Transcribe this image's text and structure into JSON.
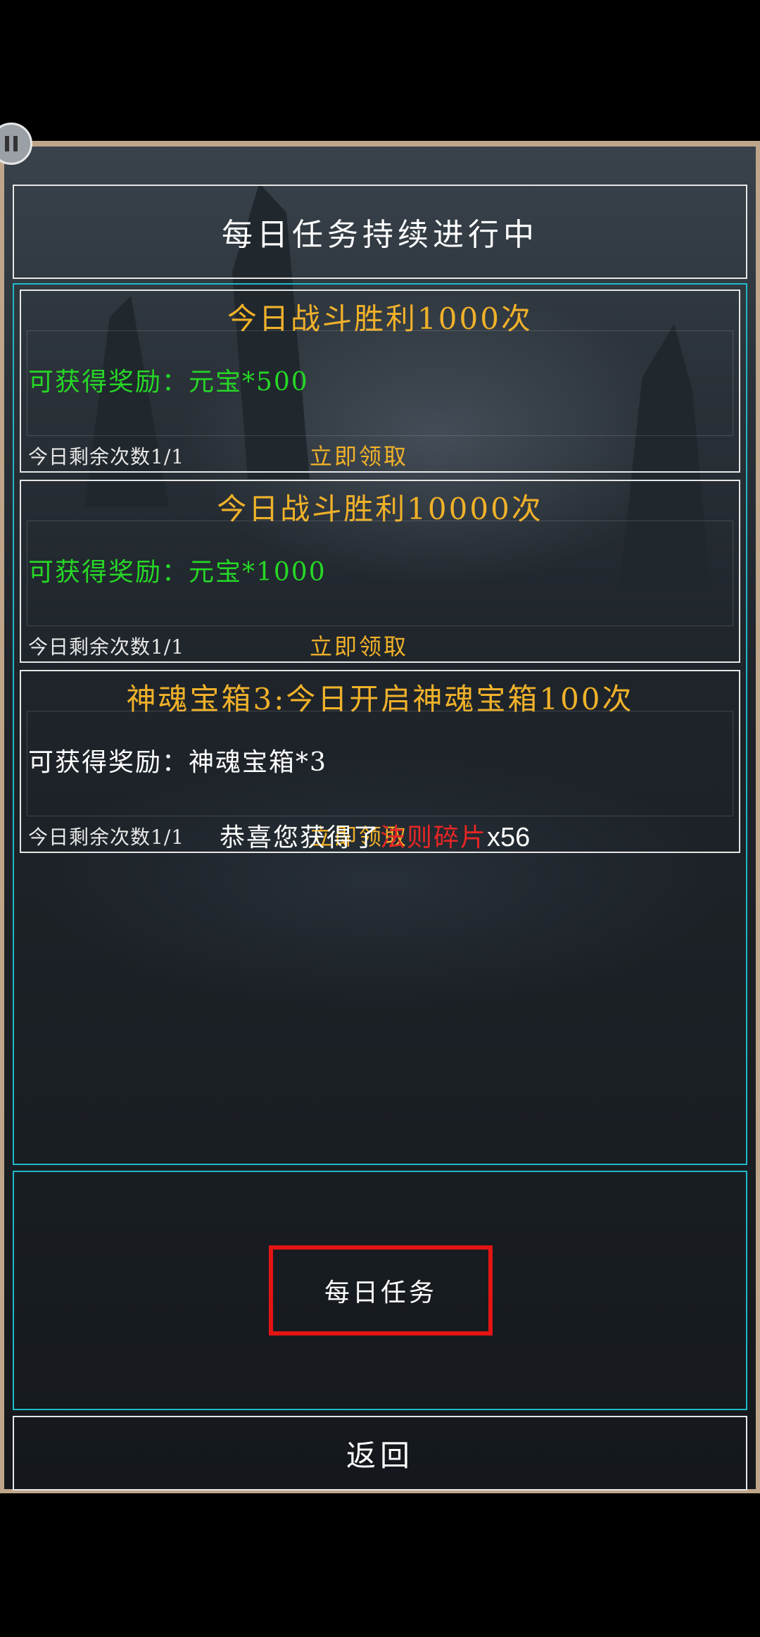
{
  "header": {
    "title": "每日任务持续进行中"
  },
  "quests": [
    {
      "title": "今日战斗胜利1000次",
      "reward": "可获得奖励：元宝*500",
      "remaining": "今日剩余次数1/1",
      "claim_label": "立即领取"
    },
    {
      "title": "今日战斗胜利10000次",
      "reward": "可获得奖励：元宝*1000",
      "remaining": "今日剩余次数1/1",
      "claim_label": "立即领取"
    },
    {
      "title": "神魂宝箱3:今日开启神魂宝箱100次",
      "reward": "可获得奖励：神魂宝箱*3",
      "remaining": "今日剩余次数1/1",
      "claim_label": "立即领取"
    }
  ],
  "toast": {
    "prefix": "恭喜您获得了",
    "item": "法则碎片",
    "count": "x56"
  },
  "tabs": {
    "daily_label": "每日任务"
  },
  "footer": {
    "back_label": "返回"
  },
  "colors": {
    "quest_title": "#f0b12a",
    "reward_green": "#26d726",
    "panel_border": "#1fb9c7",
    "highlight_red": "#e31414",
    "frame": "#bfa68a"
  }
}
